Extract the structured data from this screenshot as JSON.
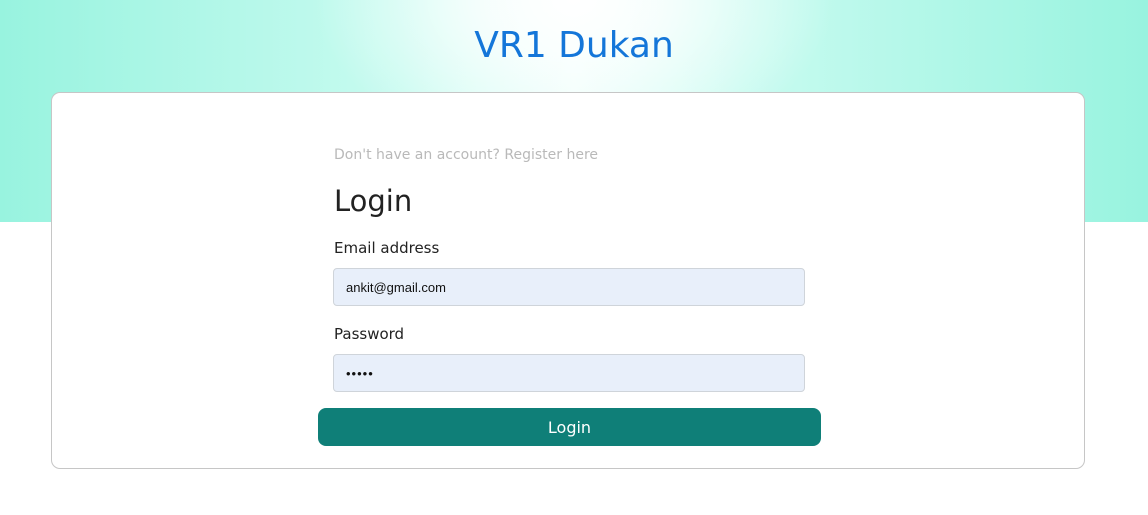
{
  "header": {
    "title": "VR1 Dukan"
  },
  "form": {
    "register_text": "Don't have an account? Register here",
    "title": "Login",
    "email_label": "Email address",
    "email_value": "ankit@gmail.com",
    "password_label": "Password",
    "password_value": "•••••",
    "submit_label": "Login"
  },
  "colors": {
    "brand_title": "#1476d9",
    "hero_mint": "#98f3df",
    "button": "#0f7f78",
    "input_bg": "#e8effa"
  }
}
